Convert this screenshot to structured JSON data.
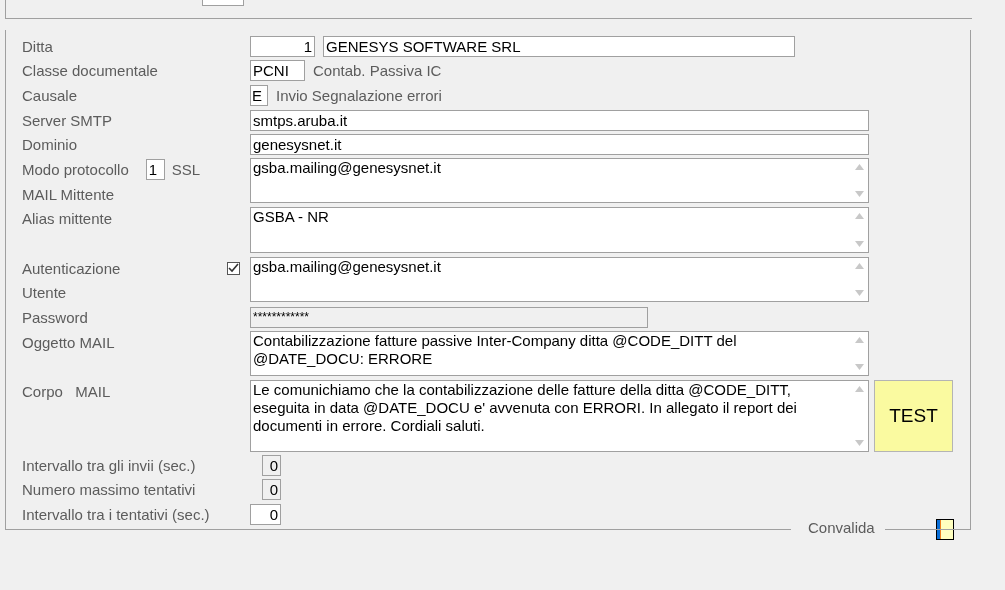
{
  "ditta": {
    "label": "Ditta",
    "code": "1",
    "value": "GENESYS SOFTWARE SRL"
  },
  "classe": {
    "label": "Classe documentale",
    "code": "PCNI",
    "description": "Contab. Passiva IC"
  },
  "causale": {
    "label": "Causale",
    "code": "E",
    "description": "Invio Segnalazione errori"
  },
  "server": {
    "label": "Server SMTP",
    "value": "smtps.aruba.it"
  },
  "dominio": {
    "label": "Dominio",
    "value": "genesysnet.it"
  },
  "protocollo": {
    "label": "Modo protocollo",
    "code": "1",
    "description": "SSL"
  },
  "mittente": {
    "label": "MAIL Mittente",
    "value": "gsba.mailing@genesysnet.it"
  },
  "alias": {
    "label": "Alias mittente",
    "value": "GSBA - NR"
  },
  "autenticazione": {
    "label": "Autenticazione",
    "checked": true
  },
  "utente": {
    "label": "Utente",
    "value": "gsba.mailing@genesysnet.it"
  },
  "password": {
    "label": "Password",
    "value": "************",
    "disabled": true
  },
  "oggetto": {
    "label": "Oggetto MAIL",
    "value": "Contabilizzazione fatture passive Inter-Company ditta @CODE_DITT del @DATE_DOCU: ERRORE"
  },
  "corpo": {
    "label": "Corpo   MAIL",
    "value": "Le comunichiamo che la contabilizzazione delle fatture della ditta @CODE_DITT, eseguita in data @DATE_DOCU e' avvenuta con ERRORI. In allegato il report dei documenti in errore. Cordiali saluti."
  },
  "test_button": {
    "label": "TEST"
  },
  "numbers": [
    {
      "label": "Intervallo tra gli invii (sec.)",
      "value": "0"
    },
    {
      "label": "Numero massimo tentativi",
      "value": "0"
    },
    {
      "label": "Intervallo tra i tentativi (sec.)",
      "value": "0"
    }
  ],
  "footer": {
    "label": "Convalida"
  }
}
